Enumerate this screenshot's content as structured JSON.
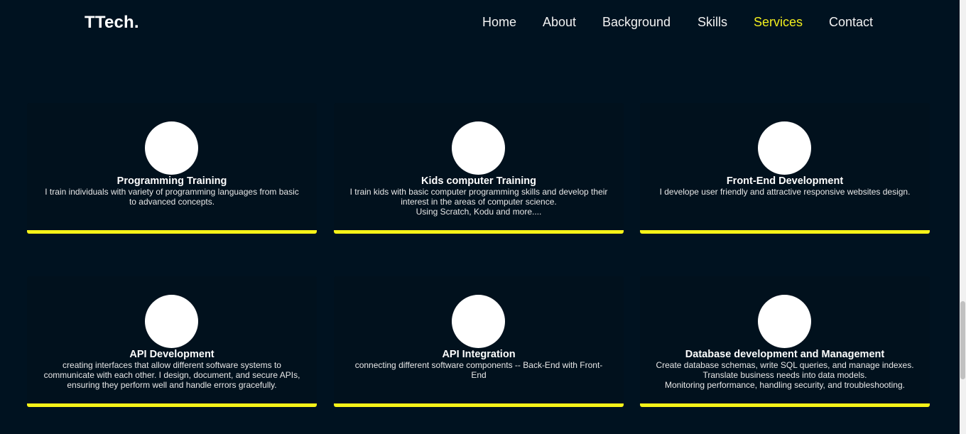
{
  "logo": "TTech.",
  "nav": [
    {
      "label": "Home"
    },
    {
      "label": "About"
    },
    {
      "label": "Background"
    },
    {
      "label": "Skills"
    },
    {
      "label": "Services",
      "active": true
    },
    {
      "label": "Contact"
    }
  ],
  "services": [
    {
      "title": "Programming Training",
      "desc": [
        "I train individuals with variety of programming languages from basic to advanced concepts."
      ]
    },
    {
      "title": "Kids computer Training",
      "desc": [
        "I train kids with basic computer programming skills and develop their interest in the areas of computer science.",
        "Using Scratch, Kodu and more...."
      ]
    },
    {
      "title": "Front-End Development",
      "desc": [
        "I develope user friendly and attractive responsive websites design."
      ]
    },
    {
      "title": "API Development",
      "desc": [
        "creating interfaces that allow different software systems to communicate with each other. I design, document, and secure APIs, ensuring they perform well and handle errors gracefully."
      ]
    },
    {
      "title": "API Integration",
      "desc": [
        "connecting different software components -- Back-End with Front-End"
      ]
    },
    {
      "title": "Database development and Management",
      "desc": [
        "Create database schemas, write SQL queries, and manage indexes.",
        "Translate business needs into data models.",
        "Monitoring performance, handling security, and troubleshooting."
      ]
    }
  ],
  "colors": {
    "background": "#001220",
    "accent": "#f7f218",
    "text": "#ffffff"
  }
}
